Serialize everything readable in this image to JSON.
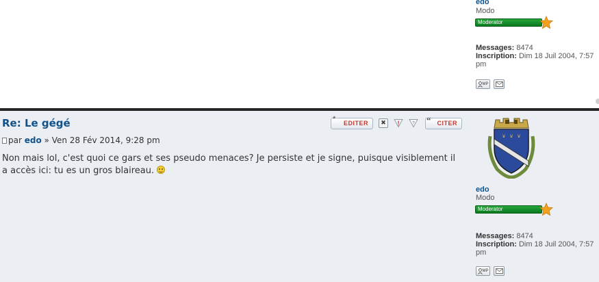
{
  "top_profile": {
    "username": "edo",
    "rank_title": "Modo",
    "rank_badge": "Moderator",
    "messages_label": "Messages:",
    "messages_value": "8474",
    "joined_label": "Inscription:",
    "joined_value": "Dim 18 Juil 2004, 7:57 pm",
    "pm_label": "MP"
  },
  "post": {
    "title": "Re: Le gégé",
    "meta_by": "par",
    "meta_author": "edo",
    "meta_date": "» Ven 28 Fév 2014, 9:28 pm",
    "content": "Non mais lol, c'est quoi ce gars et ses pseudo menaces? Je persiste et je signe, puisque visiblement il a accès ici: tu es un gros blaireau.",
    "buttons": {
      "edit": "EDITER",
      "delete": "✖",
      "quote": "CITER"
    },
    "icons": {
      "post": "post-icon",
      "edit": "star-icon",
      "delete": "delete-icon",
      "warn": "warning-icon",
      "info": "info-icon",
      "quote": "quote-icon",
      "smiley": "smiley-icon",
      "email": "envelope-icon",
      "pm": "user-icon"
    }
  },
  "profile": {
    "avatar_alt": "avatar",
    "username": "edo",
    "rank_title": "Modo",
    "rank_badge": "Moderator",
    "messages_label": "Messages:",
    "messages_value": "8474",
    "joined_label": "Inscription:",
    "joined_value": "Dim 18 Juil 2004, 7:57 pm",
    "pm_label": "MP"
  },
  "colors": {
    "accent": "#105289",
    "post_bg": "#ebeef2",
    "button_text": "#c6362e",
    "rank_green": "#1a8f2e",
    "divider": "#262626"
  }
}
